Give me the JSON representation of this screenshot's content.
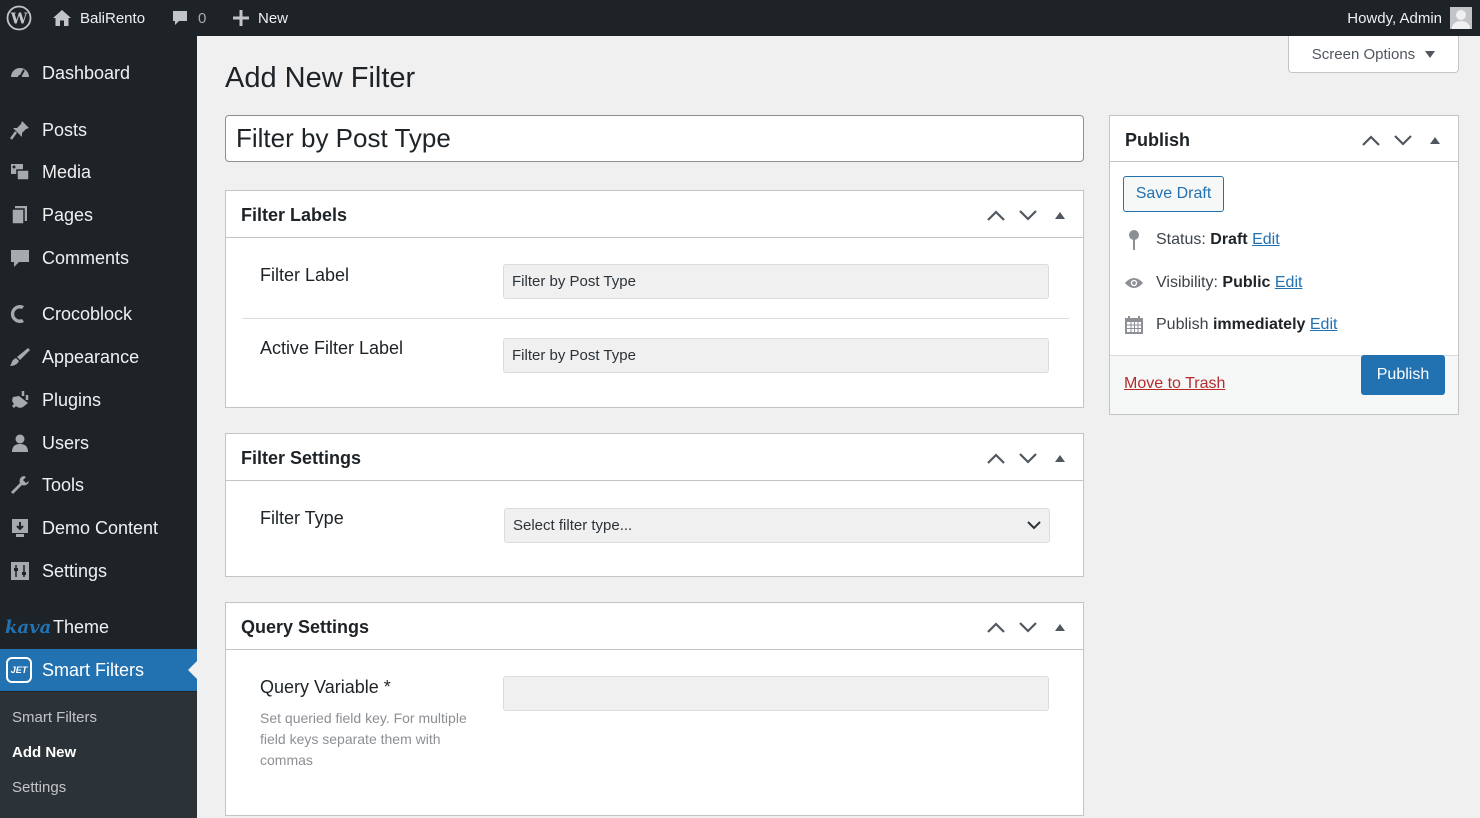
{
  "admin_bar": {
    "site_name": "BaliRento",
    "comments_count": "0",
    "new_label": "New",
    "howdy": "Howdy, Admin"
  },
  "sidebar": {
    "items": [
      {
        "label": "Dashboard",
        "icon": "dashboard-icon"
      },
      {
        "label": "Posts",
        "icon": "pin-icon"
      },
      {
        "label": "Media",
        "icon": "media-icon"
      },
      {
        "label": "Pages",
        "icon": "pages-icon"
      },
      {
        "label": "Comments",
        "icon": "comment-icon"
      },
      {
        "label": "Crocoblock",
        "icon": "crocoblock-icon"
      },
      {
        "label": "Appearance",
        "icon": "brush-icon"
      },
      {
        "label": "Plugins",
        "icon": "plugin-icon"
      },
      {
        "label": "Users",
        "icon": "user-icon"
      },
      {
        "label": "Tools",
        "icon": "wrench-icon"
      },
      {
        "label": "Demo Content",
        "icon": "download-icon"
      },
      {
        "label": "Settings",
        "icon": "settings-icon"
      },
      {
        "label": "Theme",
        "icon": "kava-logo",
        "logo_text": "kava"
      },
      {
        "label": "Smart Filters",
        "icon": "jet-icon",
        "logo_text": "JET"
      }
    ],
    "submenu": [
      "Smart Filters",
      "Add New",
      "Settings"
    ],
    "current_submenu": "Add New"
  },
  "screen_options": "Screen Options",
  "page_title": "Add New Filter",
  "post_title": "Filter by Post Type",
  "boxes": {
    "filter_labels": {
      "title": "Filter Labels",
      "filter_label": "Filter Label",
      "filter_label_value": "Filter by Post Type",
      "active_label": "Active Filter Label",
      "active_label_value": "Filter by Post Type"
    },
    "filter_settings": {
      "title": "Filter Settings",
      "filter_type": "Filter Type",
      "filter_type_value": "Select filter type..."
    },
    "query_settings": {
      "title": "Query Settings",
      "query_variable": "Query Variable *",
      "query_variable_value": "",
      "description": "Set queried field key. For multiple field keys separate them with commas"
    }
  },
  "publish": {
    "title": "Publish",
    "save_draft": "Save Draft",
    "status_label": "Status:",
    "status_value": "Draft",
    "visibility_label": "Visibility:",
    "visibility_value": "Public",
    "publish_label": "Publish",
    "publish_value": "immediately",
    "edit": "Edit",
    "trash": "Move to Trash",
    "publish_button": "Publish"
  },
  "colors": {
    "admin_bar": "#1d2327",
    "accent": "#2271b1",
    "background": "#f0f0f1",
    "trash": "#b32d2e"
  }
}
